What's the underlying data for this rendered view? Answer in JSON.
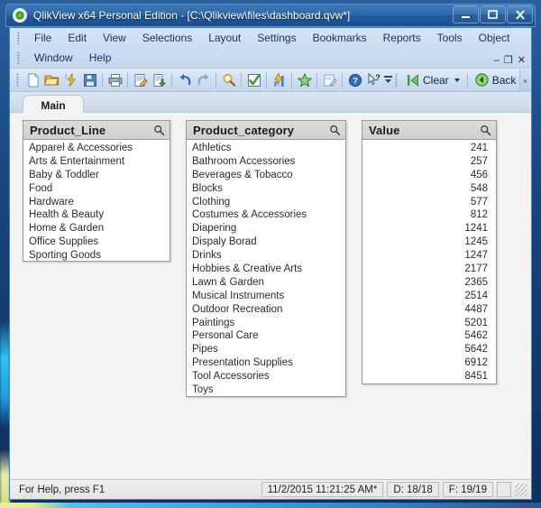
{
  "window": {
    "title": "QlikView x64 Personal Edition - [C:\\Qlikview\\files\\dashboard.qvw*]",
    "app_icon": "qlikview-logo-icon",
    "controls": {
      "minimize": "minimize-icon",
      "maximize": "maximize-icon",
      "close": "close-icon"
    }
  },
  "menubar": {
    "row1": [
      {
        "label": "File"
      },
      {
        "label": "Edit"
      },
      {
        "label": "View"
      },
      {
        "label": "Selections"
      },
      {
        "label": "Layout"
      },
      {
        "label": "Settings"
      },
      {
        "label": "Bookmarks"
      },
      {
        "label": "Reports"
      },
      {
        "label": "Tools"
      },
      {
        "label": "Object"
      }
    ],
    "row2": [
      {
        "label": "Window"
      },
      {
        "label": "Help"
      }
    ],
    "mdi_controls": {
      "minimize": "–",
      "restore": "❐",
      "close": "✕"
    }
  },
  "toolbar": {
    "buttons": [
      {
        "name": "new-document-icon",
        "tip": "New"
      },
      {
        "name": "open-document-icon",
        "tip": "Open"
      },
      {
        "name": "reload-icon",
        "tip": "Reload"
      },
      {
        "name": "save-icon",
        "tip": "Save"
      },
      {
        "name": "print-icon",
        "tip": "Print"
      },
      {
        "name": "edit-script-icon",
        "tip": "Edit Script"
      },
      {
        "name": "reload-data-icon",
        "tip": "Reload Data"
      },
      {
        "name": "undo-icon",
        "tip": "Undo"
      },
      {
        "name": "redo-icon",
        "tip": "Redo"
      },
      {
        "name": "search-icon",
        "tip": "Search"
      },
      {
        "name": "current-selections-icon",
        "tip": "Current Selections"
      },
      {
        "name": "chart-wizard-icon",
        "tip": "Quick Chart Wizard"
      },
      {
        "name": "favorites-icon",
        "tip": "Add Bookmark"
      },
      {
        "name": "notes-icon",
        "tip": "Notes"
      },
      {
        "name": "help-icon",
        "tip": "Help"
      },
      {
        "name": "context-help-icon",
        "tip": "What's This"
      }
    ],
    "clear_label": "Clear",
    "back_label": "Back",
    "overflow_label": "»"
  },
  "sheet": {
    "tab_label": "Main"
  },
  "listboxes": [
    {
      "id": "product-line",
      "title": "Product_Line",
      "search_icon": "search-icon",
      "numeric": false,
      "items": [
        "Apparel & Accessories",
        "Arts & Entertainment",
        "Baby & Toddler",
        "Food",
        "Hardware",
        "Health & Beauty",
        "Home & Garden",
        "Office Supplies",
        "Sporting Goods"
      ]
    },
    {
      "id": "product-category",
      "title": "Product_category",
      "search_icon": "search-icon",
      "numeric": false,
      "items": [
        "Athletics",
        "Bathroom Accessories",
        "Beverages & Tobacco",
        "Blocks",
        "Clothing",
        "Costumes & Accessories",
        "Diapering",
        "Dispaly Borad",
        "Drinks",
        "Hobbies & Creative Arts",
        "Lawn & Garden",
        "Musical Instruments",
        "Outdoor Recreation",
        "Paintings",
        "Personal Care",
        "Pipes",
        "Presentation Supplies",
        "Tool Accessories",
        "Toys"
      ]
    },
    {
      "id": "value",
      "title": "Value",
      "search_icon": "search-icon",
      "numeric": true,
      "items": [
        "241",
        "257",
        "456",
        "548",
        "577",
        "812",
        "1241",
        "1245",
        "1247",
        "2177",
        "2365",
        "2514",
        "4487",
        "5201",
        "5462",
        "5642",
        "6912",
        "8451"
      ]
    }
  ],
  "statusbar": {
    "help_text": "For Help, press F1",
    "timestamp": "11/2/2015 11:21:25 AM*",
    "documents": "D: 18/18",
    "fields": "F: 19/19"
  },
  "colors": {
    "title_blue": "#2d69ab",
    "menu_blue": "#c3d8ef",
    "sheet_gray": "#f3f3f3",
    "caption_gray": "#d4d4d4",
    "accent_green": "#3f9b35"
  }
}
